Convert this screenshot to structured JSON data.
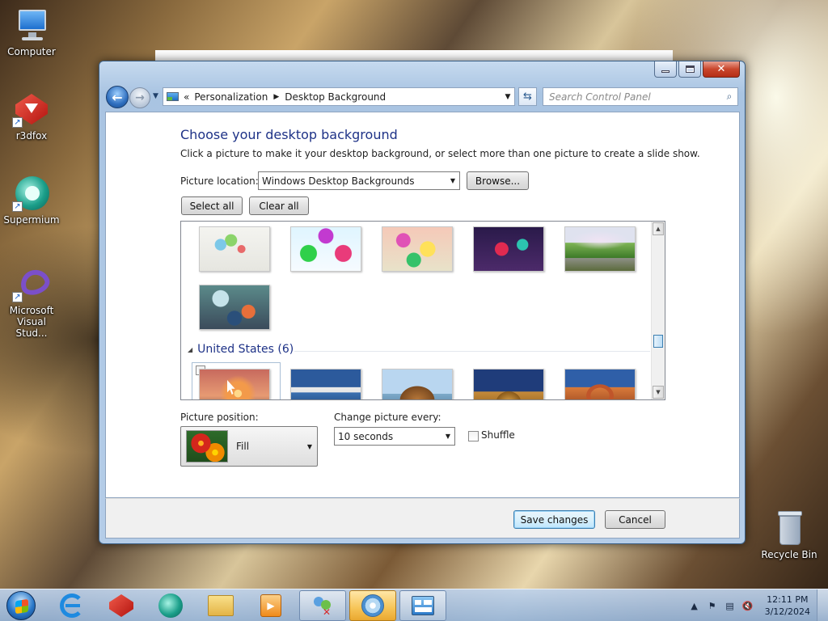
{
  "desktop": {
    "icons": [
      {
        "label": "Computer"
      },
      {
        "label": "r3dfox"
      },
      {
        "label": "Supermium"
      },
      {
        "label": "Microsoft Visual Stud..."
      },
      {
        "label": "Recycle Bin"
      }
    ]
  },
  "window": {
    "address": {
      "overflow": "«",
      "crumb1": "Personalization",
      "crumb2": "Desktop Background"
    },
    "search_placeholder": "Search Control Panel",
    "heading": "Choose your desktop background",
    "description": "Click a picture to make it your desktop background, or select more than one picture to create a slide show.",
    "picture_location_label": "Picture location:",
    "picture_location_value": "Windows Desktop Backgrounds",
    "browse_label": "Browse...",
    "select_all_label": "Select all",
    "clear_all_label": "Clear all",
    "group_title": "United States (6)",
    "picture_position_label": "Picture position:",
    "picture_position_value": "Fill",
    "change_every_label": "Change picture every:",
    "change_every_value": "10 seconds",
    "shuffle_label": "Shuffle",
    "save_label": "Save changes",
    "cancel_label": "Cancel"
  },
  "taskbar": {
    "time": "12:11 PM",
    "date": "3/12/2024"
  },
  "colors": {
    "heading": "#1e3287",
    "accent": "#3c7fb1"
  }
}
